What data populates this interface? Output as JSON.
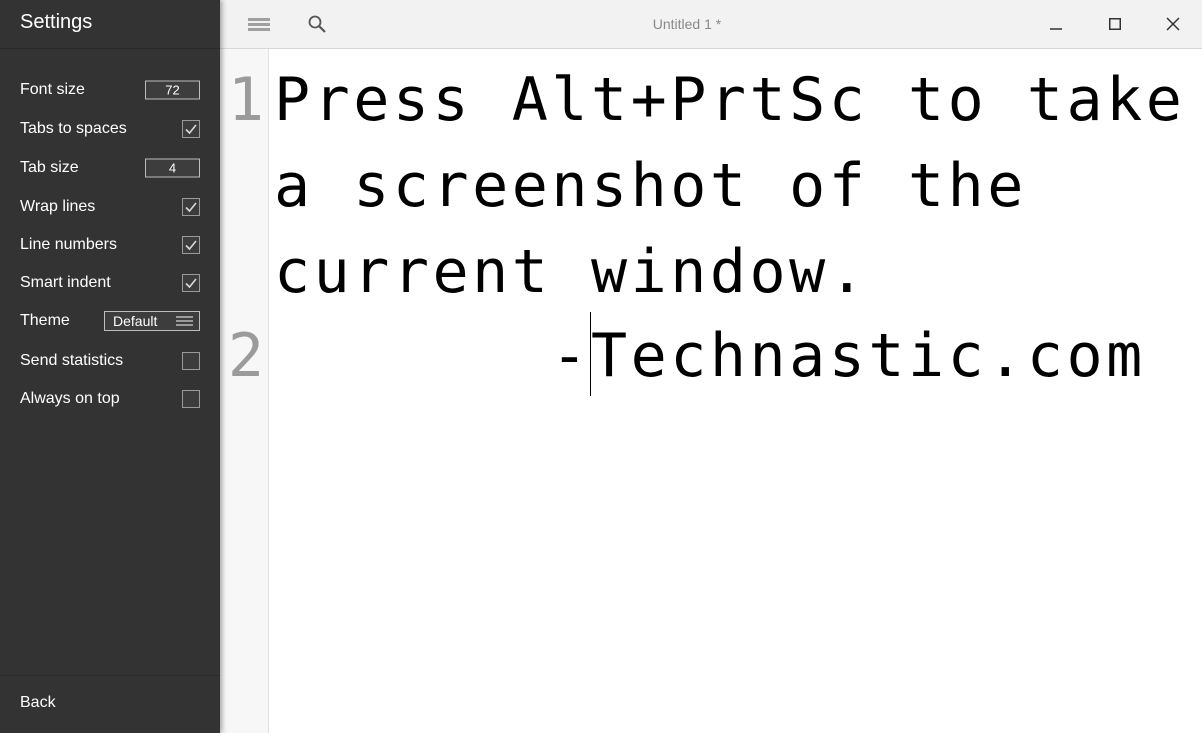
{
  "settings": {
    "title": "Settings",
    "font_size": {
      "label": "Font size",
      "value": "72"
    },
    "tabs_to_spaces": {
      "label": "Tabs to spaces",
      "checked": true
    },
    "tab_size": {
      "label": "Tab size",
      "value": "4"
    },
    "wrap_lines": {
      "label": "Wrap lines",
      "checked": true
    },
    "line_numbers": {
      "label": "Line numbers",
      "checked": true
    },
    "smart_indent": {
      "label": "Smart indent",
      "checked": true
    },
    "theme": {
      "label": "Theme",
      "value": "Default"
    },
    "send_statistics": {
      "label": "Send statistics",
      "checked": false
    },
    "always_on_top": {
      "label": "Always on top",
      "checked": false
    },
    "back_label": "Back"
  },
  "topbar": {
    "title": "Untitled 1 *",
    "icons": [
      "menu-icon",
      "search-icon",
      "minimize-icon",
      "maximize-icon",
      "close-icon"
    ]
  },
  "editor": {
    "line_numbers": [
      "1",
      "2"
    ],
    "line1_wrapped": [
      "Press Alt+PrtSc to take",
      "a screenshot of the",
      "current window."
    ],
    "line2": "       -Technastic.com"
  },
  "colors": {
    "sidebar_bg": "#333333",
    "topbar_bg": "#f2f2f2",
    "editor_bg": "#ffffff",
    "line_number": "#9b9b9b"
  }
}
